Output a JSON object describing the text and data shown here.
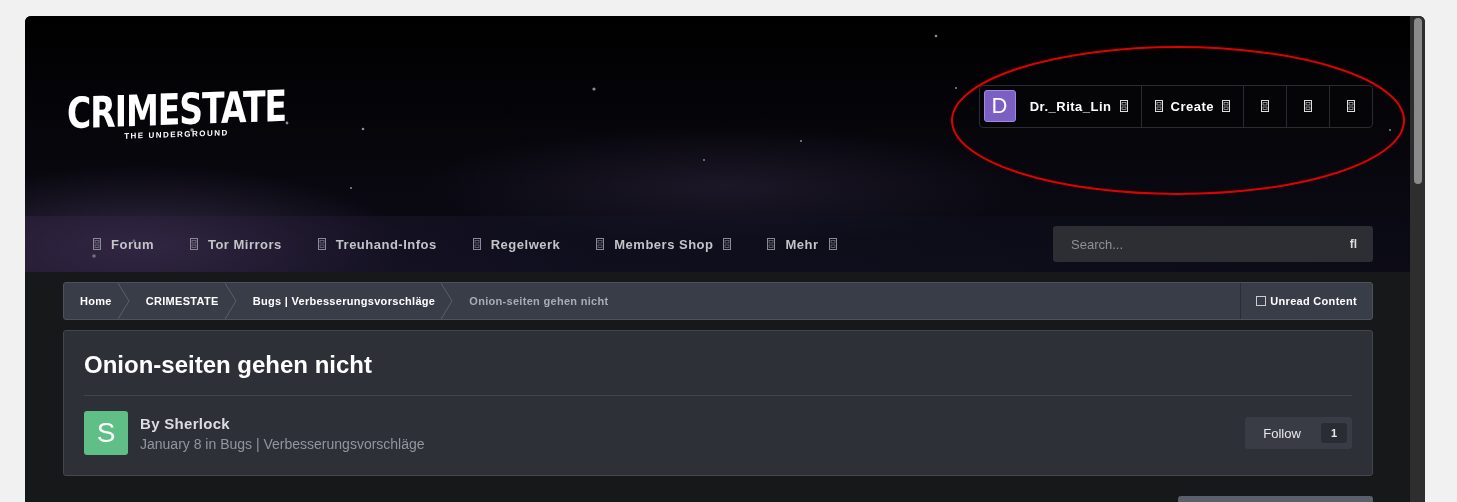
{
  "logo": {
    "title": "CRIMESTATE",
    "subtitle": "THE UNDERGROUND"
  },
  "user_bar": {
    "avatar_letter": "D",
    "username": "Dr._Rita_Lin",
    "create": "Create"
  },
  "nav": [
    {
      "label": "Forum",
      "has_menu": false
    },
    {
      "label": "Tor Mirrors",
      "has_menu": false
    },
    {
      "label": "Treuhand-Infos",
      "has_menu": false
    },
    {
      "label": "Regelwerk",
      "has_menu": false
    },
    {
      "label": "Members Shop",
      "has_menu": true
    },
    {
      "label": "Mehr",
      "has_menu": true
    }
  ],
  "search": {
    "placeholder": "Search...",
    "button": "fl"
  },
  "breadcrumbs": [
    {
      "label": "Home",
      "current": false
    },
    {
      "label": "CRIMESTATE",
      "current": false
    },
    {
      "label": "Bugs | Verbesserungsvorschläge",
      "current": false
    },
    {
      "label": "Onion-seiten gehen nicht",
      "current": true
    }
  ],
  "unread": "Unread Content",
  "topic": {
    "title": "Onion-seiten gehen nicht",
    "avatar_letter": "S",
    "author": "By Sherlock",
    "meta": "January 8 in Bugs | Verbesserungsvorschläge",
    "follow": "Follow",
    "follow_count": "1"
  }
}
